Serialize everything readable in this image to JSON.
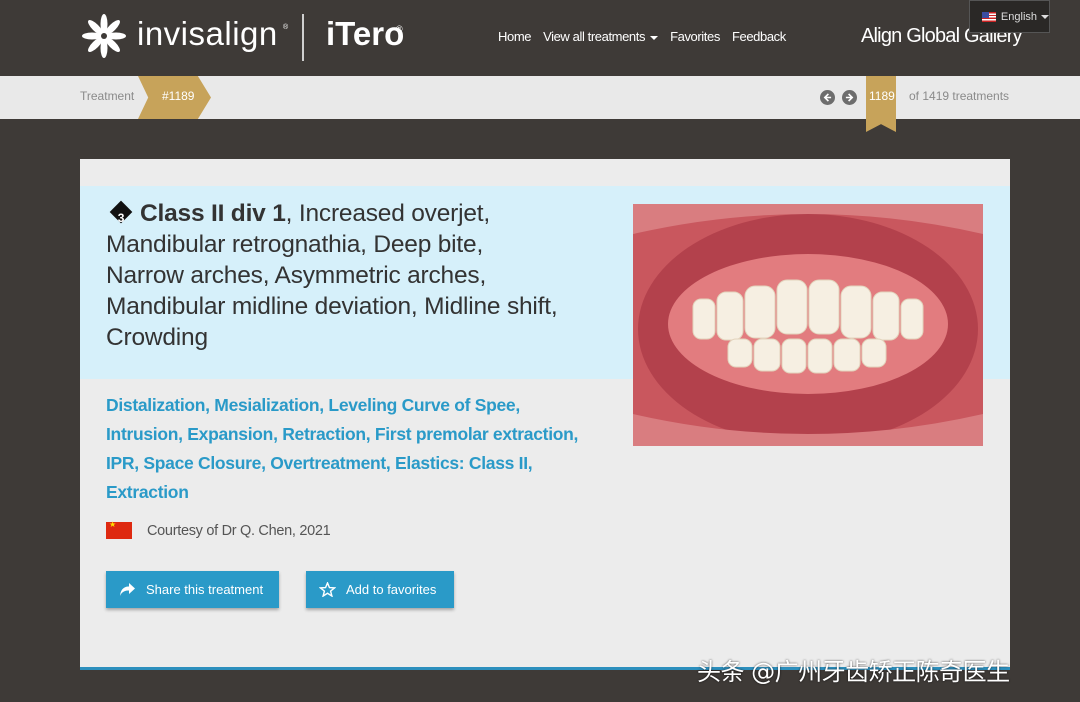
{
  "brand": {
    "name": "invisalign",
    "partner": "iTero",
    "tm": "®",
    "reg": "®"
  },
  "nav": {
    "items": [
      {
        "label": "Home"
      },
      {
        "label": "View all treatments",
        "dropdown": true
      },
      {
        "label": "Favorites"
      },
      {
        "label": "Feedback"
      }
    ],
    "gallery_title": "Align Global Gallery",
    "language": "English"
  },
  "breadcrumb": {
    "label": "Treatment",
    "current": "#1189",
    "page_number": "1189",
    "page_total": "of 1419 treatments"
  },
  "case": {
    "complexity": "3",
    "primary": "Class II div 1",
    "title_rest_1": " Increased overjet,",
    "title_line_2": "Mandibular retrognathia, Deep bite,",
    "title_line_3": "Narrow arches, Asymmetric arches,",
    "title_line_4": "Mandibular midline deviation, Midline shift,",
    "title_line_5": "Crowding",
    "treatments_line_1": "Distalization, Mesialization, Leveling Curve of Spee,",
    "treatments_line_2": "Intrusion, Expansion, Retraction, First premolar extraction,",
    "treatments_line_3": "IPR, Space Closure, Overtreatment, Elastics: Class II,",
    "treatments_line_4": "Extraction",
    "courtesy": "Courtesy of Dr Q. Chen, 2021",
    "share_label": "Share this treatment",
    "favorite_label": "Add to favorites"
  },
  "watermark": "头条 @广州牙齿矫正陈奇医生",
  "colors": {
    "accent": "#2a9ac8",
    "gold": "#c7a35a",
    "header": "#3e3a37",
    "band": "#d6f0fa"
  }
}
